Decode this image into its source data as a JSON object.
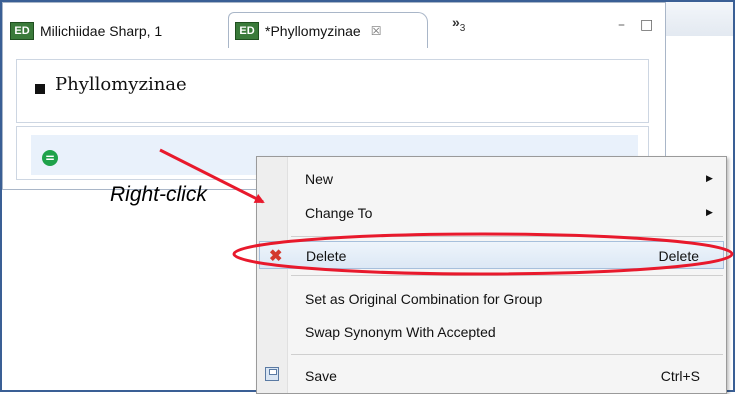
{
  "tabs": [
    {
      "label": "Milichiidae Sharp, 1",
      "icon": "taxon-editor-icon",
      "icon_text": "ED"
    },
    {
      "label": "*Phyllomyzinae",
      "icon": "taxon-editor-icon",
      "icon_text": "ED",
      "close": "☒"
    }
  ],
  "overflow": {
    "chevron": "»",
    "count": "3"
  },
  "window_controls": {
    "minimize": "–",
    "maximize": "□"
  },
  "editor": {
    "taxon_name": "Phyllomyzinae",
    "group_icon_symbol": "="
  },
  "annotation": {
    "label": "Right-click",
    "color": "#e8192c"
  },
  "context_menu": {
    "items": [
      {
        "label": "New",
        "submenu": "▶"
      },
      {
        "label": "Change To",
        "submenu": "▶"
      },
      {
        "label": "Delete",
        "shortcut": "Delete",
        "icon": "delete-x-icon",
        "icon_char": "✖"
      },
      {
        "label": "Set as Original Combination for Group"
      },
      {
        "label": "Swap Synonym With Accepted"
      },
      {
        "label": "Save",
        "shortcut": "Ctrl+S",
        "icon": "save-icon"
      }
    ]
  }
}
